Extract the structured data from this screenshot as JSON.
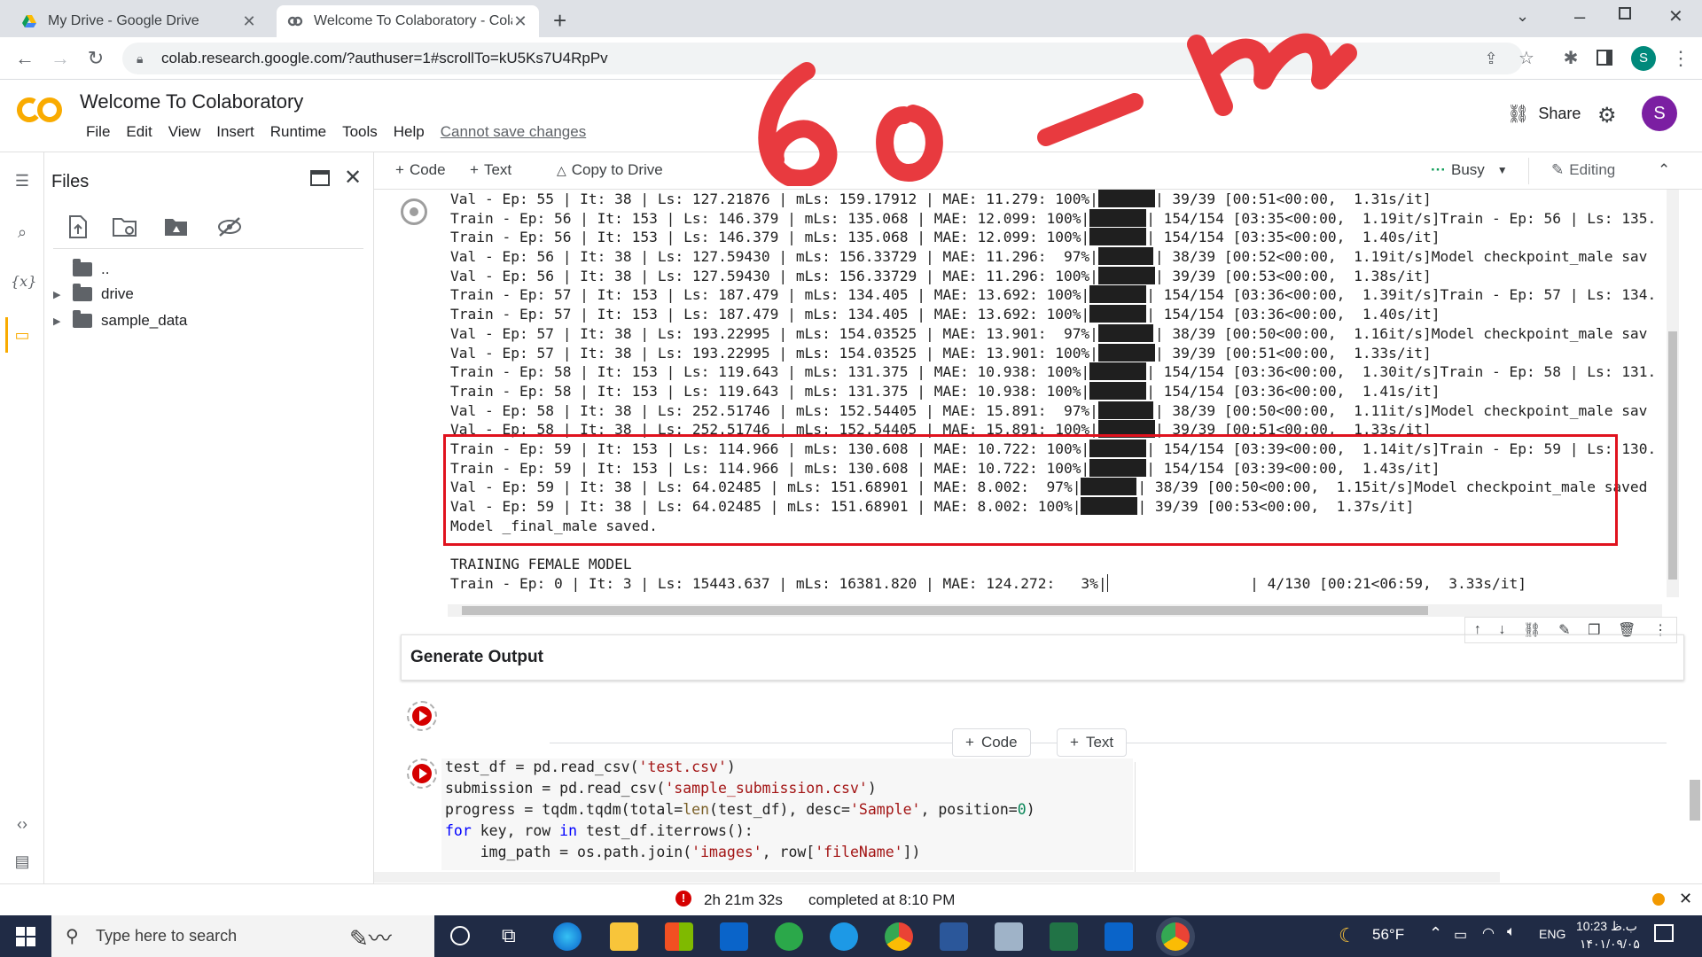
{
  "browser": {
    "tabs": [
      {
        "title": "My Drive - Google Drive"
      },
      {
        "title": "Welcome To Colaboratory - Cola"
      }
    ],
    "new_tab": "+",
    "url": "colab.research.google.com/?authuser=1#scrollTo=kU5Ks7U4RpPv",
    "profile_initial": "S"
  },
  "colab": {
    "logo_text": "CO",
    "title": "Welcome To Colaboratory",
    "menu": [
      "File",
      "Edit",
      "View",
      "Insert",
      "Runtime",
      "Tools",
      "Help"
    ],
    "cannot_save": "Cannot save changes",
    "share_label": "Share",
    "avatar_initial": "S"
  },
  "files_panel": {
    "title": "Files",
    "tree": [
      {
        "label": ".."
      },
      {
        "label": "drive"
      },
      {
        "label": "sample_data"
      }
    ]
  },
  "notebook_toolbar": {
    "code_label": "Code",
    "text_label": "Text",
    "copy_label": "Copy to Drive",
    "busy_label": "Busy",
    "editing_label": "Editing"
  },
  "output": {
    "lines": [
      {
        "pre": "Val - Ep: 55 | It: 38 | Ls: 127.21876 | mLs: 159.17912 | MAE: 11.279: 100%|",
        "bar": 80,
        "post": "| 39/39 [00:51<00:00,  1.31s/it]"
      },
      {
        "pre": "Train - Ep: 56 | It: 153 | Ls: 146.379 | mLs: 135.068 | MAE: 12.099: 100%|",
        "bar": 80,
        "post": "| 154/154 [03:35<00:00,  1.19it/s]Train - Ep: 56 | Ls: 135."
      },
      {
        "pre": "Train - Ep: 56 | It: 153 | Ls: 146.379 | mLs: 135.068 | MAE: 12.099: 100%|",
        "bar": 80,
        "post": "| 154/154 [03:35<00:00,  1.40s/it]"
      },
      {
        "pre": "Val - Ep: 56 | It: 38 | Ls: 127.59430 | mLs: 156.33729 | MAE: 11.296:  97%|",
        "bar": 78,
        "post": "| 38/39 [00:52<00:00,  1.19it/s]Model checkpoint_male sav"
      },
      {
        "pre": "Val - Ep: 56 | It: 38 | Ls: 127.59430 | mLs: 156.33729 | MAE: 11.296: 100%|",
        "bar": 80,
        "post": "| 39/39 [00:53<00:00,  1.38s/it]"
      },
      {
        "pre": "Train - Ep: 57 | It: 153 | Ls: 187.479 | mLs: 134.405 | MAE: 13.692: 100%|",
        "bar": 80,
        "post": "| 154/154 [03:36<00:00,  1.39it/s]Train - Ep: 57 | Ls: 134."
      },
      {
        "pre": "Train - Ep: 57 | It: 153 | Ls: 187.479 | mLs: 134.405 | MAE: 13.692: 100%|",
        "bar": 80,
        "post": "| 154/154 [03:36<00:00,  1.40s/it]"
      },
      {
        "pre": "Val - Ep: 57 | It: 38 | Ls: 193.22995 | mLs: 154.03525 | MAE: 13.901:  97%|",
        "bar": 78,
        "post": "| 38/39 [00:50<00:00,  1.16it/s]Model checkpoint_male sav"
      },
      {
        "pre": "Val - Ep: 57 | It: 38 | Ls: 193.22995 | mLs: 154.03525 | MAE: 13.901: 100%|",
        "bar": 80,
        "post": "| 39/39 [00:51<00:00,  1.33s/it]"
      },
      {
        "pre": "Train - Ep: 58 | It: 153 | Ls: 119.643 | mLs: 131.375 | MAE: 10.938: 100%|",
        "bar": 80,
        "post": "| 154/154 [03:36<00:00,  1.30it/s]Train - Ep: 58 | Ls: 131."
      },
      {
        "pre": "Train - Ep: 58 | It: 153 | Ls: 119.643 | mLs: 131.375 | MAE: 10.938: 100%|",
        "bar": 80,
        "post": "| 154/154 [03:36<00:00,  1.41s/it]"
      },
      {
        "pre": "Val - Ep: 58 | It: 38 | Ls: 252.51746 | mLs: 152.54405 | MAE: 15.891:  97%|",
        "bar": 78,
        "post": "| 38/39 [00:50<00:00,  1.11it/s]Model checkpoint_male sav"
      },
      {
        "pre": "Val - Ep: 58 | It: 38 | Ls: 252.51746 | mLs: 152.54405 | MAE: 15.891: 100%|",
        "bar": 80,
        "post": "| 39/39 [00:51<00:00,  1.33s/it]"
      },
      {
        "pre": "Train - Ep: 59 | It: 153 | Ls: 114.966 | mLs: 130.608 | MAE: 10.722: 100%|",
        "bar": 80,
        "post": "| 154/154 [03:39<00:00,  1.14it/s]Train - Ep: 59 | Ls: 130."
      },
      {
        "pre": "Train - Ep: 59 | It: 153 | Ls: 114.966 | mLs: 130.608 | MAE: 10.722: 100%|",
        "bar": 80,
        "post": "| 154/154 [03:39<00:00,  1.43s/it]"
      },
      {
        "pre": "Val - Ep: 59 | It: 38 | Ls: 64.02485 | mLs: 151.68901 | MAE: 8.002:  97%|",
        "bar": 78,
        "post": "| 38/39 [00:50<00:00,  1.15it/s]Model checkpoint_male saved"
      },
      {
        "pre": "Val - Ep: 59 | It: 38 | Ls: 64.02485 | mLs: 151.68901 | MAE: 8.002: 100%|",
        "bar": 80,
        "post": "| 39/39 [00:53<00:00,  1.37s/it]"
      },
      {
        "pre": "Model _final_male saved.",
        "bar": 0,
        "post": ""
      },
      {
        "pre": "",
        "bar": 0,
        "post": ""
      },
      {
        "pre": "TRAINING FEMALE MODEL",
        "bar": 0,
        "post": ""
      },
      {
        "pre": "Train - Ep: 0 | It: 3 | Ls: 15443.637 | mLs: 16381.820 | MAE: 124.272:   3%|",
        "bar": 2,
        "post": "          | 4/130 [00:21<06:59,  3.33s/it]"
      }
    ]
  },
  "text_cell": {
    "title": "Generate Output"
  },
  "add_buttons": {
    "code": "Code",
    "text": "Text"
  },
  "code_cell": {
    "lines": [
      "test_df = pd.read_csv('test.csv')",
      "submission = pd.read_csv('sample_submission.csv')",
      "progress = tqdm.tqdm(total=len(test_df), desc='Sample', position=0)",
      "for key, row in test_df.iterrows():",
      "    img_path = os.path.join('images', row['fileName'])"
    ]
  },
  "status_bar": {
    "elapsed": "2h 21m 32s",
    "completed": "completed at 8:10 PM"
  },
  "taskbar": {
    "search_placeholder": "Type here to search",
    "weather": "56°F",
    "lang": "ENG",
    "time": "10:23 ب.ظ",
    "date": "۱۴۰۱/۰۹/۰۵"
  },
  "colors": {
    "accent_red": "#e0121e",
    "colab_orange": "#f9ab00",
    "taskbar": "#202b45"
  }
}
